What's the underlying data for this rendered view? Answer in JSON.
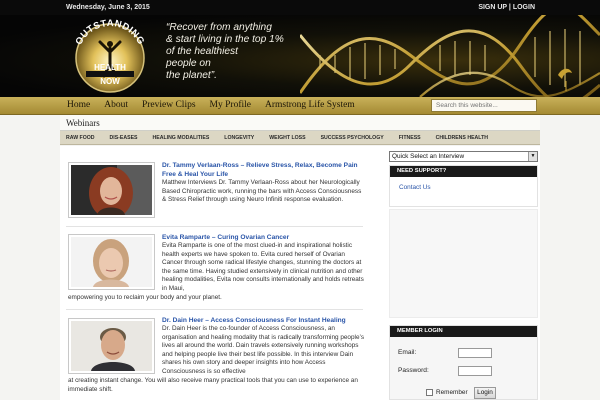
{
  "topbar": {
    "date": "Wednesday, June 3, 2015",
    "signup": "SIGN UP",
    "separator": " | ",
    "login": "LOGIN"
  },
  "header": {
    "logo_text_top": "OUTSTANDING",
    "logo_text_mid": "HEALTH",
    "logo_text_bottom": "NOW",
    "tagline_lines": [
      "“Recover from anything",
      "& start living in the top 1%",
      "of the healthiest",
      "people on",
      "the planet”."
    ]
  },
  "nav": {
    "items": [
      "Home",
      "About",
      "Preview Clips",
      "My Profile",
      "Armstrong Life System"
    ]
  },
  "search": {
    "placeholder": "Search this website..."
  },
  "page": {
    "title": "Webinars"
  },
  "categories": [
    "RAW FOOD",
    "DIS-EASES",
    "HEALING MODALITIES",
    "LONGEVITY",
    "WEIGHT LOSS",
    "SUCCESS PSYCHOLOGY",
    "FITNESS",
    "CHILDRENS HEALTH"
  ],
  "posts": [
    {
      "title": "Dr. Tammy Verlaan-Ross – Relieve Stress, Relax, Become Pain Free & Heal Your Life",
      "excerpt": "Matthew Interviews Dr. Tammy Verlaan-Ross about her Neurologically Based Chiropractic work, running the bars with Access Consciousness & Stress Relief through using Neuro Infiniti response evaluation."
    },
    {
      "title": "Evita Ramparte – Curing Ovarian Cancer",
      "excerpt_side": "Evita Ramparte is one of the most clued-in and inspirational holistic health experts we have spoken to. Evita cured herself of Ovarian Cancer through some radical lifestyle changes, stunning the doctors at the same time. Having studied extensively in clinical nutrition and other healing modalities, Evita now consults internationally and holds retreats in Maui,",
      "excerpt_full": "empowering you to reclaim your body and your planet."
    },
    {
      "title": "Dr. Dain Heer – Access Consciousness For Instant Healing",
      "excerpt_side": "Dr. Dain Heer is the co-founder of Access Consciousness, an organisation and healing modality that is radically transforming people’s lives all around the world. Dain travels extensively running workshops and helping people live their best life possible. In this interview Dain shares his own story and deeper insights into how Access Consciousness is so effective",
      "excerpt_full": "at creating instant change. You will also receive many practical tools that you can use to experience an immediate shift."
    }
  ],
  "sidebar": {
    "select_value": "Quick Select an Interview",
    "support_title": "NEED SUPPORT?",
    "support_link": "Contact Us",
    "login_title": "MEMBER LOGIN",
    "email_label": "Email:",
    "password_label": "Password:",
    "remember_label": "Remember",
    "login_button": "Login"
  },
  "colors": {
    "nav_gold": "#b89f45",
    "link_blue": "#2a55a8",
    "header_black": "#050505"
  }
}
